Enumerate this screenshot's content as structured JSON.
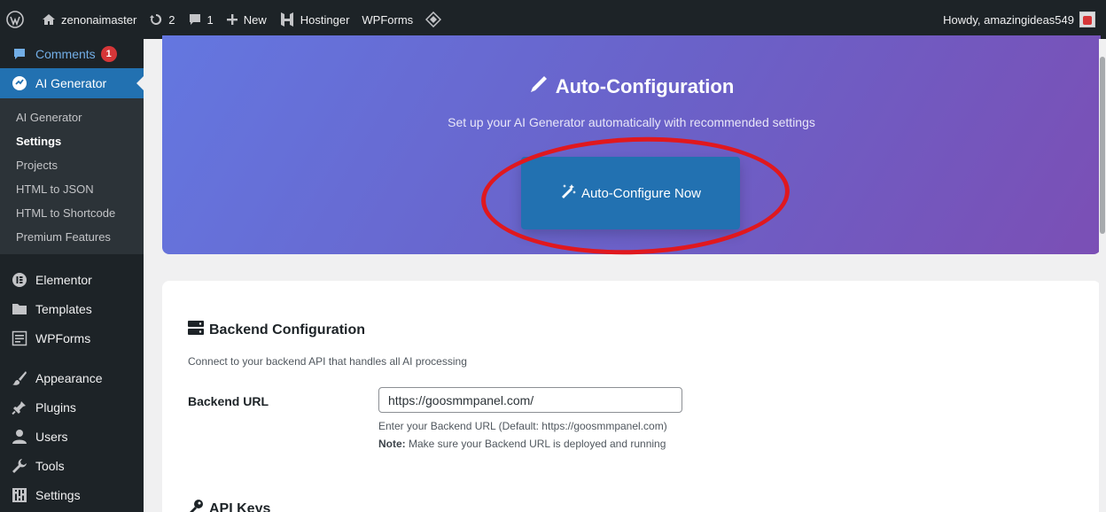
{
  "adminbar": {
    "site_name": "zenonaimaster",
    "updates_count": "2",
    "comments_count": "1",
    "new_label": "New",
    "hostinger_label": "Hostinger",
    "wpforms_label": "WPForms",
    "howdy": "Howdy, amazingideas549"
  },
  "sidebar": {
    "comments_label": "Comments",
    "comments_badge": "1",
    "ai_generator_label": "AI Generator",
    "submenu": [
      "AI Generator",
      "Settings",
      "Projects",
      "HTML to JSON",
      "HTML to Shortcode",
      "Premium Features"
    ],
    "menu": [
      "Elementor",
      "Templates",
      "WPForms",
      "Appearance",
      "Plugins",
      "Users",
      "Tools",
      "Settings"
    ]
  },
  "hero": {
    "title": "Auto-Configuration",
    "subtitle": "Set up your AI Generator automatically with recommended settings",
    "button_label": "Auto-Configure Now"
  },
  "backend": {
    "title": "Backend Configuration",
    "description": "Connect to your backend API that handles all AI processing",
    "url_label": "Backend URL",
    "url_value": "https://goosmmpanel.com/",
    "help_text": "Enter your Backend URL (Default: https://goosmmpanel.com)",
    "note_label": "Note:",
    "note_text": " Make sure your Backend URL is deployed and running"
  },
  "api_keys": {
    "title": "API Keys"
  },
  "colors": {
    "admin_dark": "#1d2327",
    "wp_blue": "#2271b1",
    "highlight_red": "#e0181e",
    "hero_start": "#6477e0",
    "hero_end": "#7b4fb5"
  }
}
